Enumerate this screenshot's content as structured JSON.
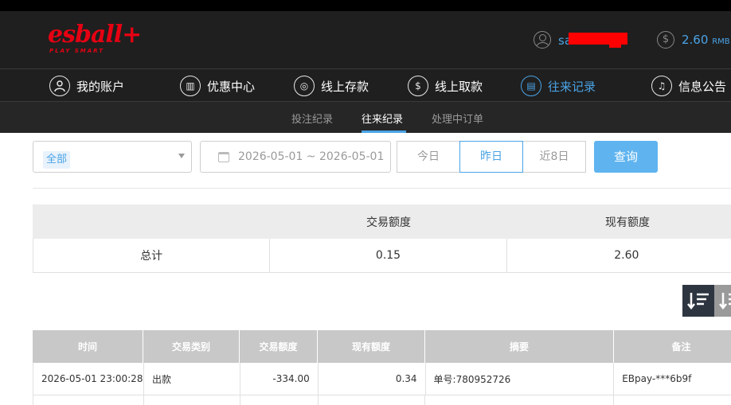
{
  "header": {
    "logo_text": "esball+",
    "logo_tagline": "PLAY SMART",
    "username": "sa",
    "balance": "2.60",
    "balance_unit": "RMB",
    "coin_symbol": "$"
  },
  "nav": {
    "items": [
      {
        "label": "我的账户",
        "icon": "account-icon",
        "glyph": ""
      },
      {
        "label": "优惠中心",
        "icon": "gift-icon",
        "glyph": "▥"
      },
      {
        "label": "线上存款",
        "icon": "deposit-icon",
        "glyph": "◎"
      },
      {
        "label": "线上取款",
        "icon": "withdraw-icon",
        "glyph": "$"
      },
      {
        "label": "往来记录",
        "icon": "records-icon",
        "glyph": "▤"
      },
      {
        "label": "信息公告",
        "icon": "bell-icon",
        "glyph": "♫"
      }
    ],
    "active_index": 4
  },
  "subnav": {
    "items": [
      "投注纪录",
      "往来纪录",
      "处理中订单"
    ],
    "active_index": 1
  },
  "filters": {
    "type_selected": "全部",
    "date_range": "2026-05-01 ~ 2026-05-01",
    "quick": [
      "今日",
      "昨日",
      "近8日"
    ],
    "quick_active_index": 1,
    "query_label": "查询"
  },
  "summary": {
    "headers": [
      "",
      "交易额度",
      "现有额度"
    ],
    "row": [
      "总计",
      "0.15",
      "2.60"
    ]
  },
  "records": {
    "headers": [
      "时间",
      "交易类别",
      "交易额度",
      "现有额度",
      "摘要",
      "备注"
    ],
    "rows": [
      [
        "2026-05-01 23:00:28",
        "出款",
        "-334.00",
        "0.34",
        "单号:780952726",
        "EBpay-***6b9f"
      ]
    ]
  },
  "colors": {
    "accent": "#4aa3e6",
    "brand_red": "#e60012",
    "header_bg": "#1f1f1f",
    "query_button": "#5fb4f0"
  }
}
